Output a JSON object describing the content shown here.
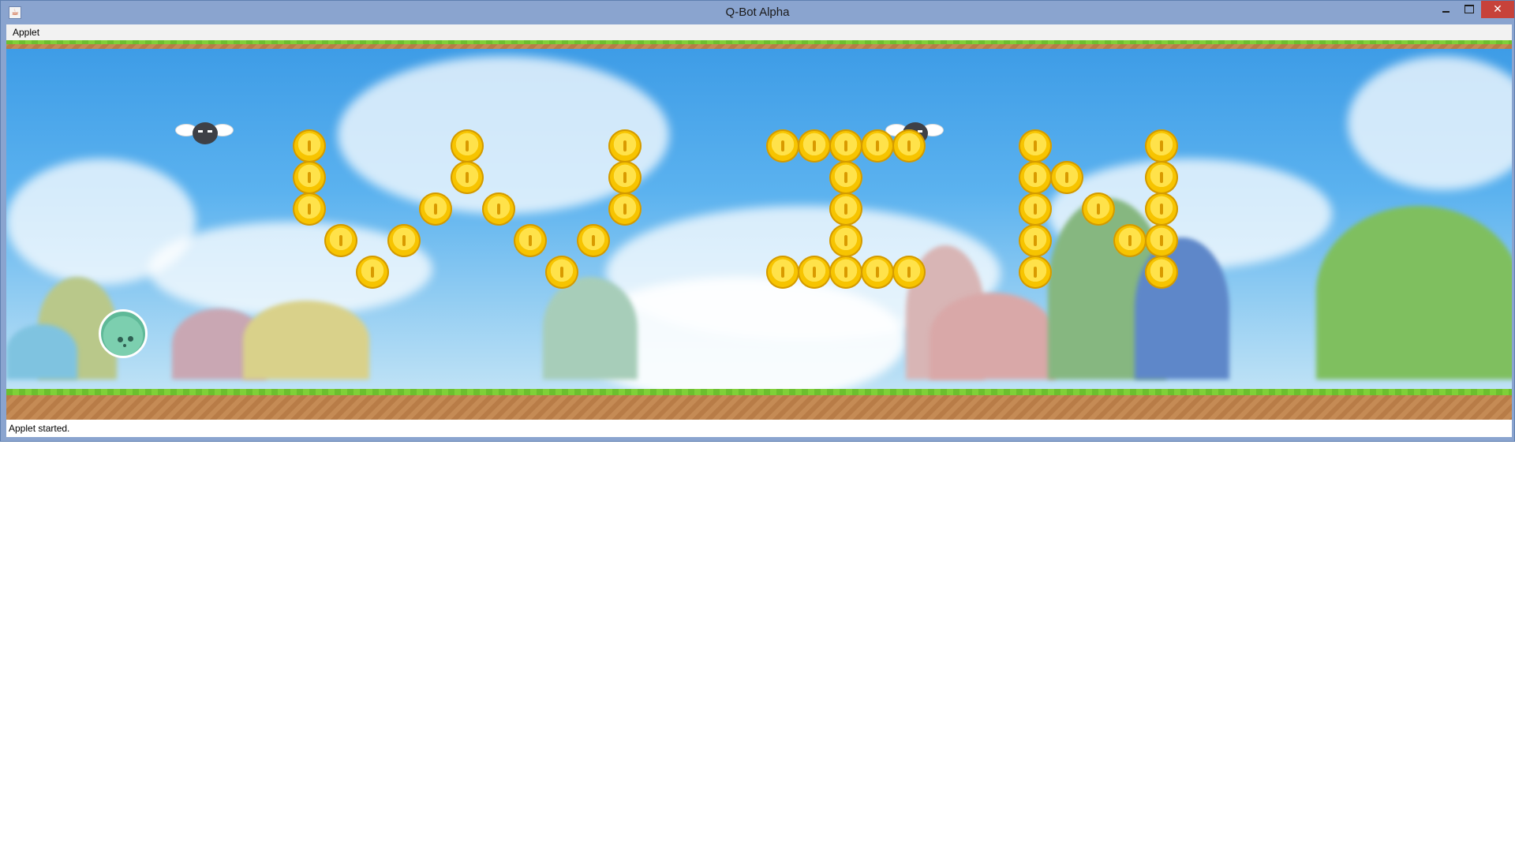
{
  "window": {
    "title": "Q-Bot Alpha",
    "icon": "java-icon",
    "controls": {
      "minimize": "minimize-icon",
      "maximize": "maximize-icon",
      "close": "close-icon",
      "close_glyph": "✕"
    }
  },
  "menubar": {
    "items": [
      {
        "label": "Applet"
      }
    ]
  },
  "game": {
    "scene": "level",
    "player": {
      "icon": "qbot-bubble-player"
    },
    "enemies": [
      {
        "type": "winged-blob-enemy"
      },
      {
        "type": "winged-blob-enemy"
      }
    ],
    "coins_icon": "gold-coin-icon",
    "colors": {
      "sky": "#3c9be6",
      "grass": "#6cbf2e",
      "dirt": "#c58b55",
      "coin": "#f7c400"
    }
  },
  "statusbar": {
    "text": "Applet started."
  }
}
